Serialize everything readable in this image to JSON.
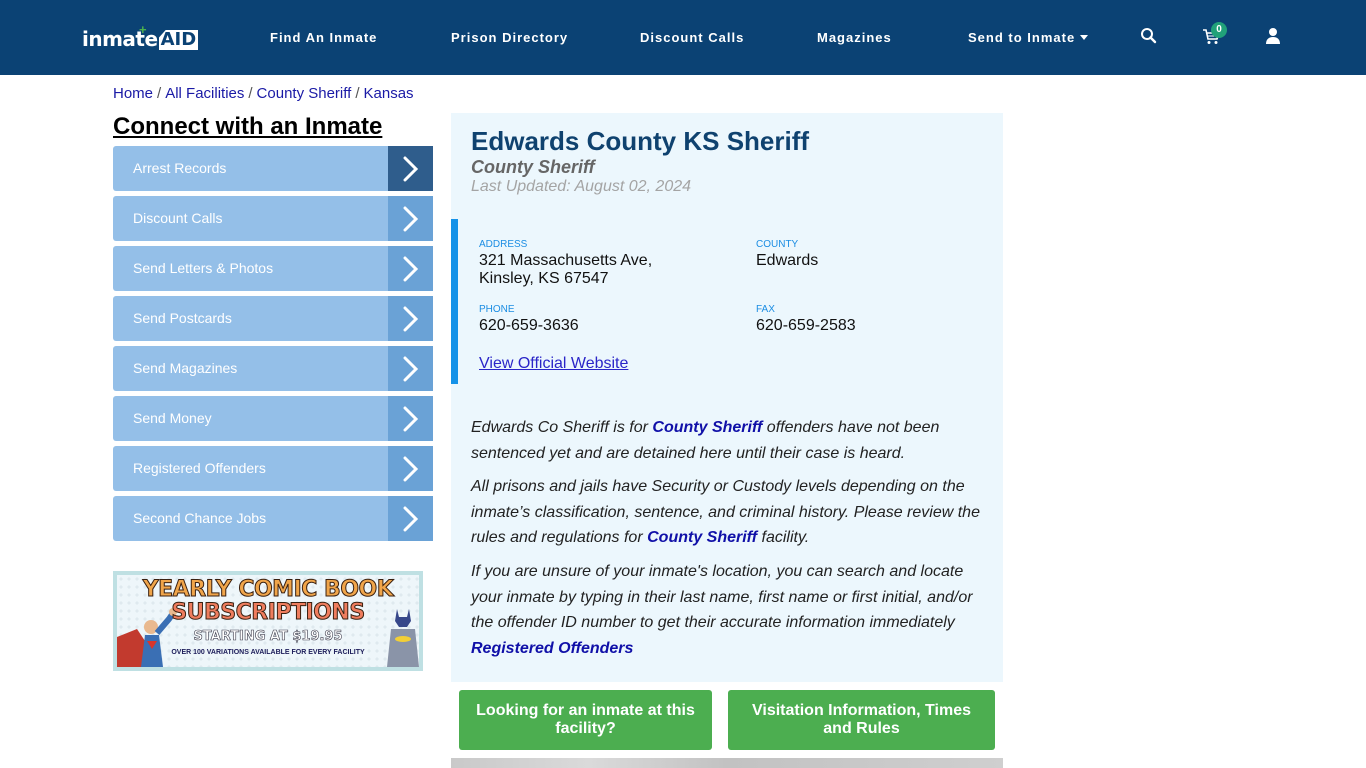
{
  "header": {
    "logo": {
      "text": "inmate",
      "accent": "AID",
      "plus": "+"
    },
    "nav": [
      {
        "label": "Find An Inmate"
      },
      {
        "label": "Prison Directory"
      },
      {
        "label": "Discount Calls"
      },
      {
        "label": "Magazines"
      },
      {
        "label": "Send to Inmate"
      }
    ],
    "cart_count": "0",
    "icons": [
      "search-icon",
      "cart-icon",
      "user-icon"
    ]
  },
  "breadcrumb": [
    {
      "label": "Home"
    },
    {
      "label": "All Facilities"
    },
    {
      "label": "County Sheriff"
    },
    {
      "label": "Kansas"
    }
  ],
  "breadcrumb_separator": "/",
  "sidebar": {
    "title": "Connect with an Inmate",
    "items": [
      {
        "label": "Arrest Records"
      },
      {
        "label": "Discount Calls"
      },
      {
        "label": "Send Letters & Photos"
      },
      {
        "label": "Send Postcards"
      },
      {
        "label": "Send Magazines"
      },
      {
        "label": "Send Money"
      },
      {
        "label": "Registered Offenders"
      },
      {
        "label": "Second Chance Jobs"
      }
    ],
    "banner": {
      "line1": "YEARLY COMIC BOOK",
      "line2": "SUBSCRIPTIONS",
      "line3": "STARTING AT $19.95",
      "line4": "OVER 100 VARIATIONS AVAILABLE FOR EVERY FACILITY"
    }
  },
  "facility": {
    "title": "Edwards County KS Sheriff",
    "type": "County Sheriff",
    "updated": "Last Updated: August 02, 2024",
    "address_label": "ADDRESS",
    "address_line1": "321 Massachusetts Ave,",
    "address_line2": "Kinsley, KS 67547",
    "county_label": "COUNTY",
    "county": "Edwards",
    "phone_label": "PHONE",
    "phone": "620-659-3636",
    "fax_label": "FAX",
    "fax": "620-659-2583",
    "website_link": "View Official Website"
  },
  "description": {
    "p1_a": "Edwards Co Sheriff is for ",
    "p1_link": "County Sheriff",
    "p1_b": " offenders have not been sentenced yet and are detained here until their case is heard.",
    "p2_a": "All prisons and jails have Security or Custody levels depending on the inmate’s classification, sentence, and criminal history. Please review the rules and regulations for ",
    "p2_link": "County Sheriff",
    "p2_b": " facility.",
    "p3": "If you are unsure of your inmate's location, you can search and locate your inmate by typing in their last name, first name or first initial, and/or the offender ID number to get their accurate information immediately",
    "p3_link": "Registered Offenders"
  },
  "actions": {
    "find_inmate": "Looking for an inmate at this facility?",
    "visitation": "Visitation Information, Times and Rules"
  },
  "colors": {
    "header_bg": "#0b4274",
    "sidebar_item": "#94bfe8",
    "sidebar_arrow": "#6aa2d6",
    "sidebar_arrow_active": "#2f5d8c",
    "card_bg": "#ecf7fd",
    "accent_blue": "#1592e8",
    "button_green": "#4cae50",
    "badge_green": "#21a179"
  }
}
